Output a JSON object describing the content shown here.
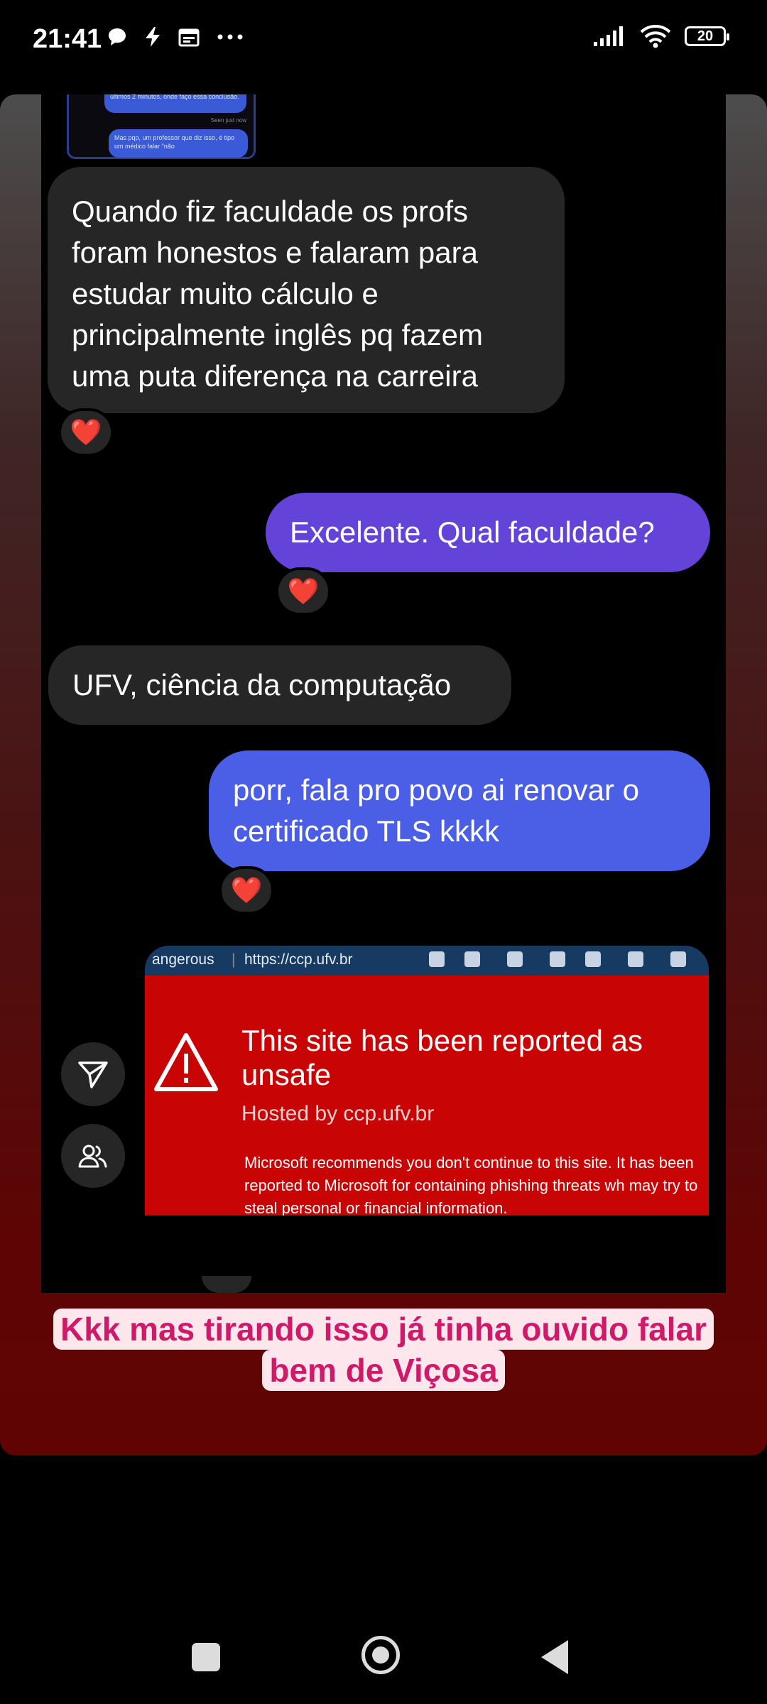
{
  "status_bar": {
    "time": "21:41",
    "left_icons": [
      "chat-bubble-icon",
      "bolt-icon",
      "calendar-icon",
      "more-icon"
    ],
    "right_icons": [
      "signal-icon",
      "wifi-icon",
      "battery-icon"
    ],
    "battery_level": "20"
  },
  "story": {
    "preview": {
      "bubble_top": "últimos 2 minutos, onde faço essa conclusão.",
      "seen": "Seen just now",
      "bubble_bottom": "Mas pqp, um professor que diz isso, é tipo um médico falar \"não"
    },
    "messages": [
      {
        "type": "received",
        "text": "Quando fiz faculdade os profs foram honestos e falaram para estudar muito cálculo e principalmente inglês pq fazem uma puta diferença na carreira",
        "reaction": "❤️"
      },
      {
        "type": "sent",
        "text": "Excelente. Qual faculdade?",
        "reaction": "❤️"
      },
      {
        "type": "received",
        "text": "UFV, ciência da computação"
      },
      {
        "type": "sent",
        "text": "porr, fala pro povo ai renovar o certificado TLS kkkk",
        "reaction": "❤️"
      }
    ],
    "image_message": {
      "browser_danger": "angerous",
      "browser_url": "https://ccp.ufv.br",
      "warning_title": "This site has been reported as unsafe",
      "hosted_by": "Hosted by ccp.ufv.br",
      "description": "Microsoft recommends you don't continue to this site. It has been reported to Microsoft for containing phishing threats wh may try to steal personal or financial information."
    },
    "caption_line1": "Kkk mas tirando isso já tinha ouvido falar",
    "caption_line2": "bem de Viçosa"
  },
  "colors": {
    "sent_bubble_1": "#6444d8",
    "sent_bubble_2": "#4b5ee6",
    "received_bubble": "#262626",
    "warning_red": "#c80404",
    "caption_text": "#cf1a6a",
    "caption_bg": "#fde6ec"
  },
  "nav_bar": {
    "buttons": [
      "recents-square-icon",
      "home-circle-icon",
      "back-triangle-icon"
    ]
  }
}
